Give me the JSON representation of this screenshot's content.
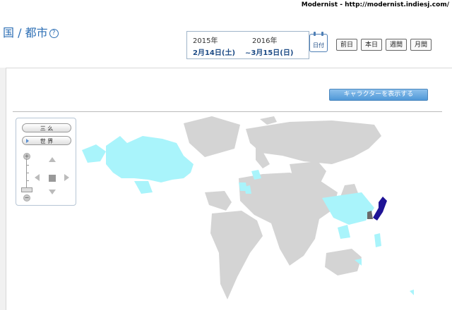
{
  "site": {
    "credit": "Modernist - http://modernist.indiesj.com/"
  },
  "header": {
    "title": "国 / 都市",
    "help": "?"
  },
  "date": {
    "start_year": "2015年",
    "end_year": "2016年",
    "start_date": "2月14日(土)",
    "end_date": "~3月15日(日)",
    "calendar_label": "日付"
  },
  "range_buttons": [
    "前日",
    "本日",
    "週間",
    "月間"
  ],
  "character_button": "キャラクターを表示する",
  "map_controls": {
    "mode_label": "三 么",
    "scope_label": "世 界",
    "plus": "+",
    "minus": "−"
  },
  "map": {
    "highlight_color": "#a9f4fb",
    "base_color": "#d4d4d4",
    "selected_color": "#1f1396"
  }
}
